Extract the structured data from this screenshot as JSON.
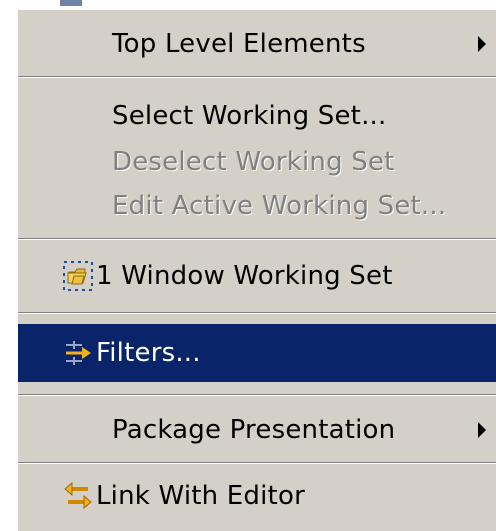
{
  "menu": {
    "items": [
      {
        "label": "Top Level Elements",
        "submenu": true,
        "enabled": true
      },
      {
        "label": "Select Working Set...",
        "enabled": true
      },
      {
        "label": "Deselect Working Set",
        "enabled": false
      },
      {
        "label": "Edit Active Working Set...",
        "enabled": false
      },
      {
        "label": "1 Window Working Set",
        "enabled": true,
        "icon": "working-set-icon"
      },
      {
        "label": "Filters...",
        "enabled": true,
        "selected": true,
        "icon": "filters-icon"
      },
      {
        "label": "Package Presentation",
        "submenu": true,
        "enabled": true
      },
      {
        "label": "Link With Editor",
        "enabled": true,
        "icon": "link-with-editor-icon"
      }
    ]
  },
  "colors": {
    "menu_background": "#d4d0c8",
    "selection_background": "#0a246a",
    "selection_text": "#ffffff",
    "disabled_text": "#808080"
  }
}
